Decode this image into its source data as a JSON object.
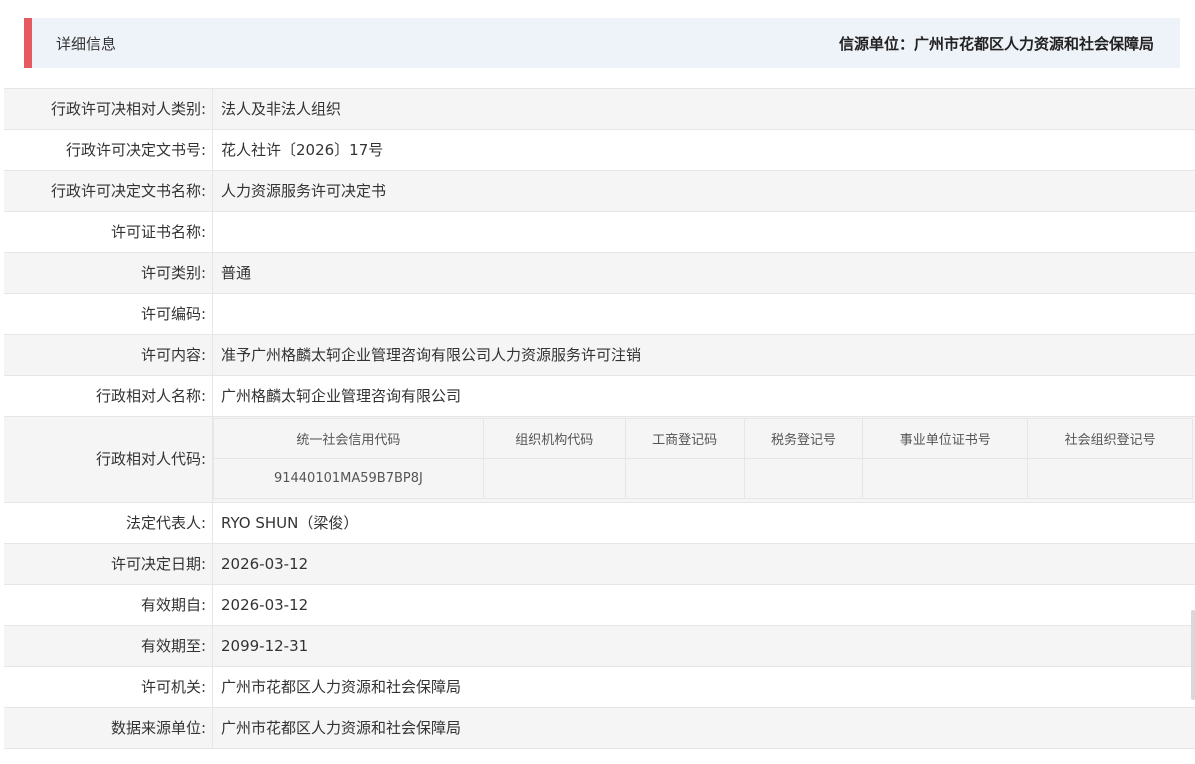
{
  "header": {
    "title": "详细信息",
    "source": "信源单位：广州市花都区人力资源和社会保障局"
  },
  "rows": [
    {
      "label": "行政许可决相对人类别:",
      "value": "法人及非法人组织"
    },
    {
      "label": "行政许可决定文书号:",
      "value": "花人社许〔2026〕17号"
    },
    {
      "label": "行政许可决定文书名称:",
      "value": "人力资源服务许可决定书"
    },
    {
      "label": "许可证书名称:",
      "value": ""
    },
    {
      "label": "许可类别:",
      "value": "普通"
    },
    {
      "label": "许可编码:",
      "value": ""
    },
    {
      "label": "许可内容:",
      "value": "准予广州格麟太轲企业管理咨询有限公司人力资源服务许可注销"
    },
    {
      "label": "行政相对人名称:",
      "value": "广州格麟太轲企业管理咨询有限公司"
    }
  ],
  "code_row": {
    "label": "行政相对人代码:",
    "headers": [
      "统一社会信用代码",
      "组织机构代码",
      "工商登记码",
      "税务登记号",
      "事业单位证书号",
      "社会组织登记号"
    ],
    "values": [
      "91440101MA59B7BP8J",
      "",
      "",
      "",
      "",
      ""
    ]
  },
  "rows_after": [
    {
      "label": "法定代表人:",
      "value": "RYO SHUN（梁俊）"
    },
    {
      "label": "许可决定日期:",
      "value": "2026-03-12"
    },
    {
      "label": "有效期自:",
      "value": "2026-03-12"
    },
    {
      "label": "有效期至:",
      "value": "2099-12-31"
    },
    {
      "label": "许可机关:",
      "value": "广州市花都区人力资源和社会保障局"
    },
    {
      "label": "数据来源单位:",
      "value": "广州市花都区人力资源和社会保障局"
    }
  ],
  "colors": {
    "accent": "#e45a5f",
    "header_bg": "#eef2f9",
    "row_alt_bg": "#f5f5f5"
  }
}
